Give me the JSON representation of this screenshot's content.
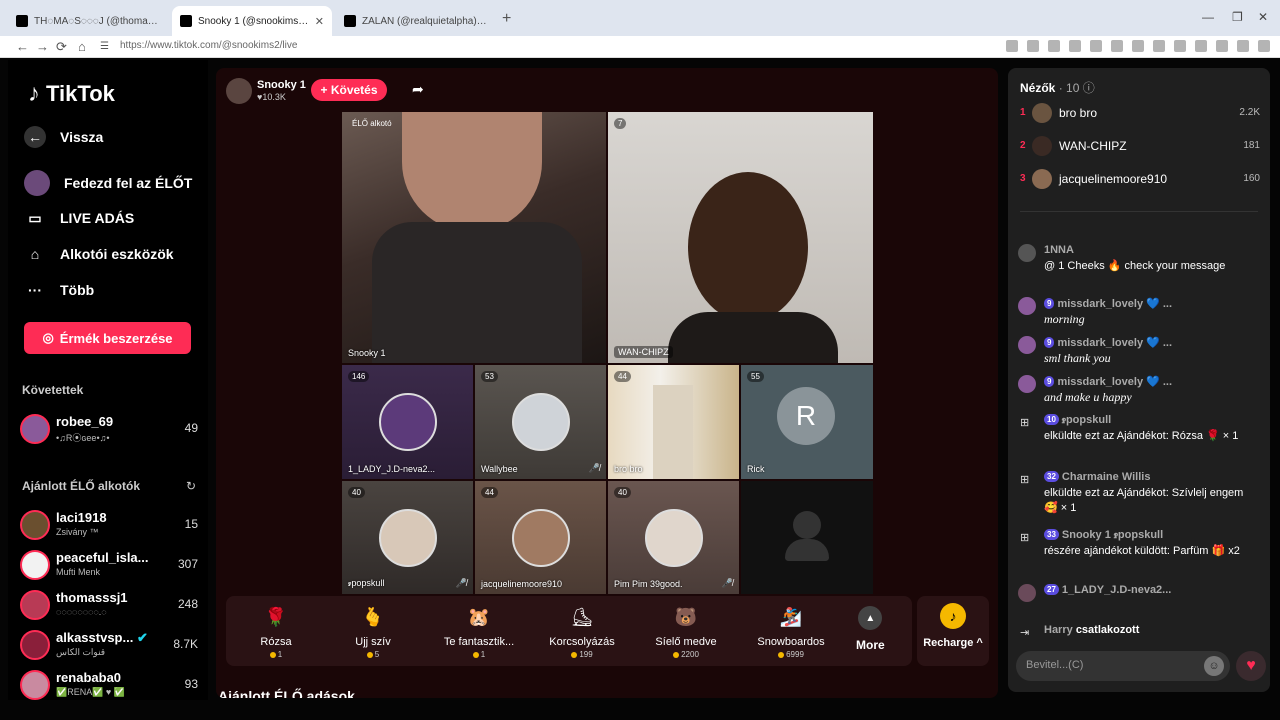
{
  "browser": {
    "tabs": [
      {
        "title": "TH◌MA◌S◌◌◌J (@thomass..."
      },
      {
        "title": "Snooky 1 (@snookims2) ÉLŐ"
      },
      {
        "title": "ZALÁN (@realquietalpha) ÉLŐ"
      }
    ],
    "close_glyph": "✕",
    "new_tab": "+",
    "url": "https://www.tiktok.com/@snookims2/live"
  },
  "sidebar": {
    "logo": "TikTok",
    "back": "Vissza",
    "nav": [
      "Fedezd fel az ÉLŐT",
      "LIVE ADÁS",
      "Alkotói eszközök",
      "Több"
    ],
    "coins_button": "Érmék beszerzése",
    "following_title": "Követettek",
    "following": [
      {
        "name": "robee_69",
        "sub": "•♫R⦿ɢee•♫•",
        "count": "49"
      }
    ],
    "suggested_title": "Ajánlott ÉLŐ alkotók",
    "suggested": [
      {
        "name": "laci1918",
        "sub": "Zsivány ™",
        "count": "15"
      },
      {
        "name": "peaceful_isla...",
        "sub": "Mufti Menk",
        "count": "307"
      },
      {
        "name": "thomasssj1",
        "sub": "◌◌◌◌◌◌◌◌.◌",
        "count": "248"
      },
      {
        "name": "alkasstvsp...",
        "sub": "قنوات الكاس",
        "count": "8.7K"
      },
      {
        "name": "renababa0",
        "sub": "✅RENA✅ ♥ ✅",
        "count": "93"
      }
    ]
  },
  "host": {
    "name": "Snooky 1",
    "likes": "♥10.3K",
    "follow": "+ Követés"
  },
  "stream": {
    "tiles": [
      {
        "label": "Snooky 1",
        "tag": "ÉLŐ alkotó",
        "badge": ""
      },
      {
        "label": "WAN-CHIPZ",
        "tag": "",
        "badge": "7"
      },
      {
        "label": "1_LADY_J.D-neva2...",
        "tag": "",
        "badge": "146"
      },
      {
        "label": "Wallybee",
        "tag": "",
        "badge": "53"
      },
      {
        "label": "bro bro",
        "tag": "",
        "badge": "44"
      },
      {
        "label": "Rick",
        "tag": "",
        "badge": "55"
      },
      {
        "label": "ꭾpopskull",
        "tag": "",
        "badge": "40"
      },
      {
        "label": "jacquelinemoore910",
        "tag": "",
        "badge": "44"
      },
      {
        "label": "Pim Pim 39good.",
        "tag": "",
        "badge": "40"
      }
    ],
    "rick_initial": "R"
  },
  "gifts": {
    "items": [
      {
        "name": "Rózsa",
        "price": "1",
        "icon": "🌹"
      },
      {
        "name": "Ujj szív",
        "price": "5",
        "icon": "🫰"
      },
      {
        "name": "Te fantasztik...",
        "price": "1",
        "icon": "🐹"
      },
      {
        "name": "Korcsolyázás",
        "price": "199",
        "icon": "⛸"
      },
      {
        "name": "Síelő medve",
        "price": "2200",
        "icon": "🐻"
      },
      {
        "name": "Snowboardos",
        "price": "6999",
        "icon": "🏂"
      }
    ],
    "more": "More",
    "recharge": "Recharge ^"
  },
  "recommended_title": "Ajánlott ÉLŐ adások",
  "viewers": {
    "title": "Nézők",
    "count": "· 10",
    "list": [
      {
        "rank": "1",
        "name": "bro bro",
        "score": "2.2K"
      },
      {
        "rank": "2",
        "name": "WAN-CHIPZ",
        "score": "181"
      },
      {
        "rank": "3",
        "name": "jacquelinemoore910",
        "score": "160"
      }
    ]
  },
  "chat": {
    "messages": [
      {
        "level": "",
        "user": "1NNA",
        "text": "@ 1 Cheeks 🔥 check your message",
        "italic": false
      },
      {
        "level": "9",
        "user": "missdark_lovely 💙 ...",
        "text": "morning",
        "italic": true
      },
      {
        "level": "9",
        "user": "missdark_lovely 💙 ...",
        "text": "sml thank you",
        "italic": true
      },
      {
        "level": "9",
        "user": "missdark_lovely 💙 ...",
        "text": "and make u happy",
        "italic": true
      },
      {
        "level": "10",
        "user": "ꭾpopskull",
        "text": "elküldte ezt az Ajándékot: Rózsa 🌹 × 1",
        "italic": false
      },
      {
        "level": "32",
        "user": "Charmaine Willis",
        "text": "elküldte ezt az Ajándékot: Szívlelj engem 🥰 × 1",
        "italic": false
      },
      {
        "level": "33",
        "user": "Snooky 1 ꭾpopskull",
        "text": "részére ajándékot küldött: Parfüm 🎁 x2",
        "italic": false
      },
      {
        "level": "27",
        "user": "1_LADY_J.D-neva2...",
        "text": "",
        "italic": false
      },
      {
        "level": "",
        "user": "Harry",
        "text": "csatlakozott",
        "italic": false
      }
    ],
    "input_placeholder": "Bevitel...(C)"
  }
}
